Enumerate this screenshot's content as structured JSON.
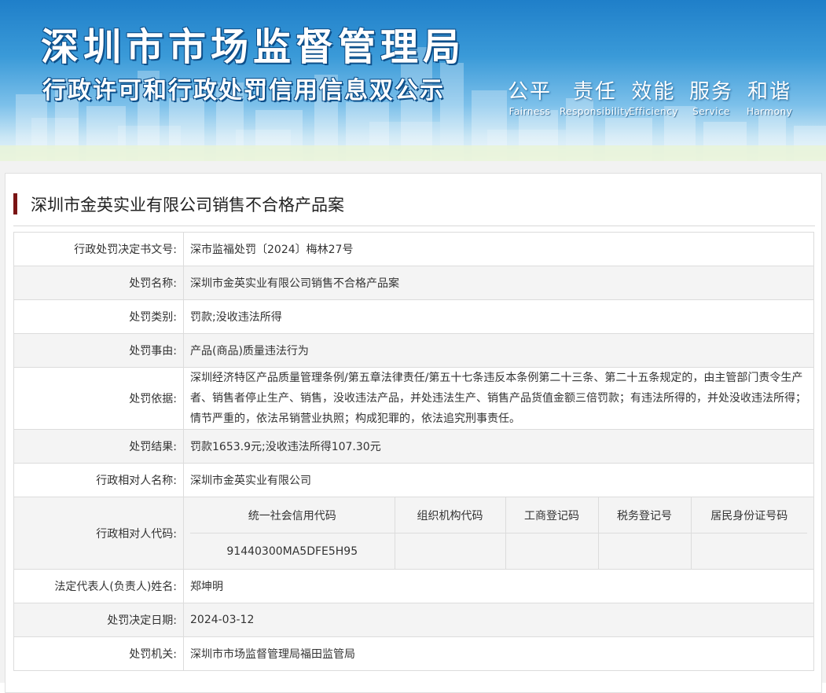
{
  "banner": {
    "title": "深圳市市场监督管理局",
    "subtitle": "行政许可和行政处罚信用信息双公示",
    "slogans": [
      {
        "zh": "公平",
        "en": "Fairness"
      },
      {
        "zh": "责任",
        "en": "Responsibility"
      },
      {
        "zh": "效能",
        "en": "Efficiency"
      },
      {
        "zh": "服务",
        "en": "Service"
      },
      {
        "zh": "和谐",
        "en": "Harmony"
      }
    ]
  },
  "case": {
    "title": "深圳市金英实业有限公司销售不合格产品案"
  },
  "rows": [
    {
      "label": "行政处罚决定书文号:",
      "value": "深市监福处罚〔2024〕梅林27号"
    },
    {
      "label": "处罚名称:",
      "value": "深圳市金英实业有限公司销售不合格产品案"
    },
    {
      "label": "处罚类别:",
      "value": "罚款;没收违法所得"
    },
    {
      "label": "处罚事由:",
      "value": "产品(商品)质量违法行为"
    },
    {
      "label": "处罚依据:",
      "value": "深圳经济特区产品质量管理条例/第五章法律责任/第五十七条违反本条例第二十三条、第二十五条规定的，由主管部门责令生产者、销售者停止生产、销售，没收违法产品，并处违法生产、销售产品货值金额三倍罚款；有违法所得的，并处没收违法所得；情节严重的，依法吊销营业执照；构成犯罪的，依法追究刑事责任。"
    },
    {
      "label": "处罚结果:",
      "value": "罚款1653.9元;没收违法所得107.30元"
    },
    {
      "label": "行政相对人名称:",
      "value": "深圳市金英实业有限公司"
    }
  ],
  "codes": {
    "label": "行政相对人代码:",
    "headers": [
      "统一社会信用代码",
      "组织机构代码",
      "工商登记码",
      "税务登记号",
      "居民身份证号码"
    ],
    "values": [
      "91440300MA5DFE5H95",
      "",
      "",
      "",
      ""
    ]
  },
  "rows_after": [
    {
      "label": "法定代表人(负责人)姓名:",
      "value": "郑坤明"
    },
    {
      "label": "处罚决定日期:",
      "value": "2024-03-12"
    },
    {
      "label": "处罚机关:",
      "value": "深圳市市场监督管理局福田监管局"
    }
  ]
}
